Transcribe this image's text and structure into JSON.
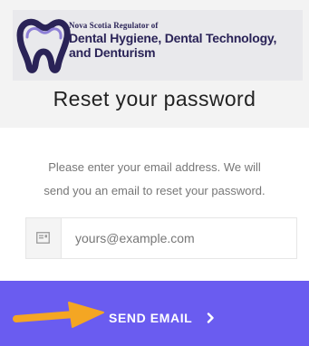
{
  "brand": {
    "org_prefix": "Nova Scotia Regulator of",
    "org_line1": "Dental Hygiene, Dental Technology,",
    "org_line2": "and Denturism",
    "primary_color": "#2a2357",
    "accent_color": "#6a5cf0",
    "logo_icon": "tooth-icon"
  },
  "page": {
    "title": "Reset your password",
    "instructions_line1": "Please enter your email address. We will",
    "instructions_line2": "send you an email to reset your password."
  },
  "form": {
    "email_icon": "email-icon",
    "email_value": "",
    "email_placeholder": "yours@example.com",
    "submit_label": "SEND EMAIL",
    "submit_icon": "chevron-right-icon"
  },
  "annotation": {
    "arrow_icon": "pointer-arrow-icon",
    "arrow_color": "#f4a623"
  }
}
